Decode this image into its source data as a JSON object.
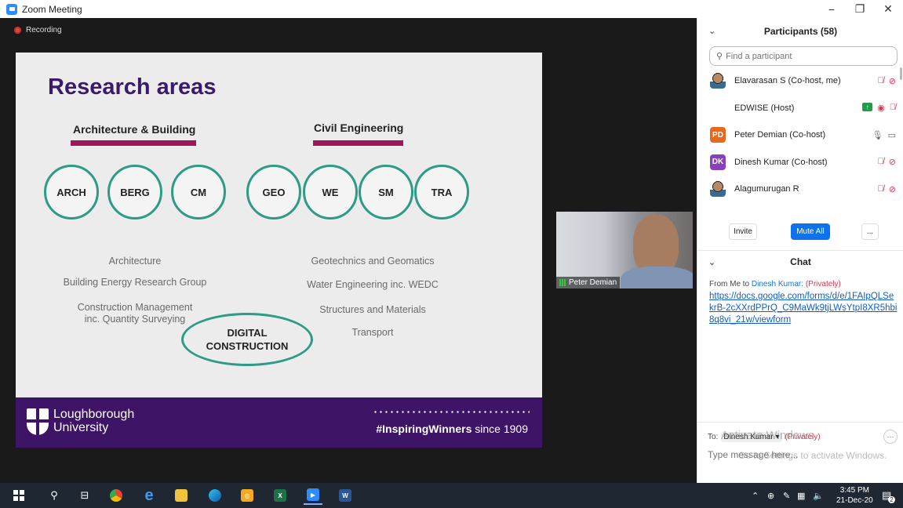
{
  "window": {
    "title": "Zoom Meeting",
    "controls": {
      "minimize": "−",
      "restore": "❐",
      "close": "✕"
    }
  },
  "meeting": {
    "recording_label": "Recording"
  },
  "slide": {
    "title": "Research areas",
    "left_heading": "Architecture & Building",
    "right_heading": "Civil Engineering",
    "circles": [
      "ARCH",
      "BERG",
      "CM",
      "GEO",
      "WE",
      "SM",
      "TRA"
    ],
    "left_descriptions": [
      "Architecture",
      "Building Energy Research Group",
      "Construction Management",
      "inc. Quantity Surveying"
    ],
    "right_descriptions": [
      "Geotechnics and Geomatics",
      "Water Engineering inc. WEDC",
      "Structures and Materials",
      "Transport"
    ],
    "digital_line1": "DIGITAL",
    "digital_line2": "CONSTRUCTION",
    "university_line1": "Loughborough",
    "university_line2": "University",
    "tagline_bold": "#InspiringWinners",
    "tagline_rest": " since 1909",
    "accent_purple": "#3d1466",
    "accent_magenta": "#a0185c",
    "circle_teal": "#2e9b84"
  },
  "video": {
    "participant_name": "Peter Demian"
  },
  "participants": {
    "header": "Participants (58)",
    "search_placeholder": "Find a participant",
    "list": [
      {
        "name": "Elavarasan S (Co-host, me)",
        "initials": "",
        "avatar_color": ""
      },
      {
        "name": "EDWISE (Host)",
        "initials": "",
        "avatar_color": ""
      },
      {
        "name": "Peter Demian (Co-host)",
        "initials": "PD",
        "avatar_color": "#e8671c"
      },
      {
        "name": "Dinesh Kumar (Co-host)",
        "initials": "DK",
        "avatar_color": "#8a3fbf"
      },
      {
        "name": "Alagumurugan R",
        "initials": "",
        "avatar_color": ""
      }
    ],
    "invite_label": "Invite",
    "mute_all_label": "Mute All",
    "more_label": "..."
  },
  "chat": {
    "header": "Chat",
    "from_prefix": "From Me to ",
    "to_name": "Dinesh Kumar:",
    "privately": "(Privately)",
    "link": "https://docs.google.com/forms/d/e/1FAIpQLSekrB-2cXXrdPPrQ_C9MaWk9tjLWsYtpI8XR5hbi8q8vi_21w/viewform",
    "to_label": "To:",
    "to_recipient": "Dinesh Kumar ▾",
    "composer_placeholder": "Type message here...",
    "watermark_line1": "Activate Windows",
    "watermark_line2": "Go to Settings to activate Windows."
  },
  "taskbar": {
    "time": "3:45 PM",
    "date": "21-Dec-20",
    "notification_count": "2"
  }
}
